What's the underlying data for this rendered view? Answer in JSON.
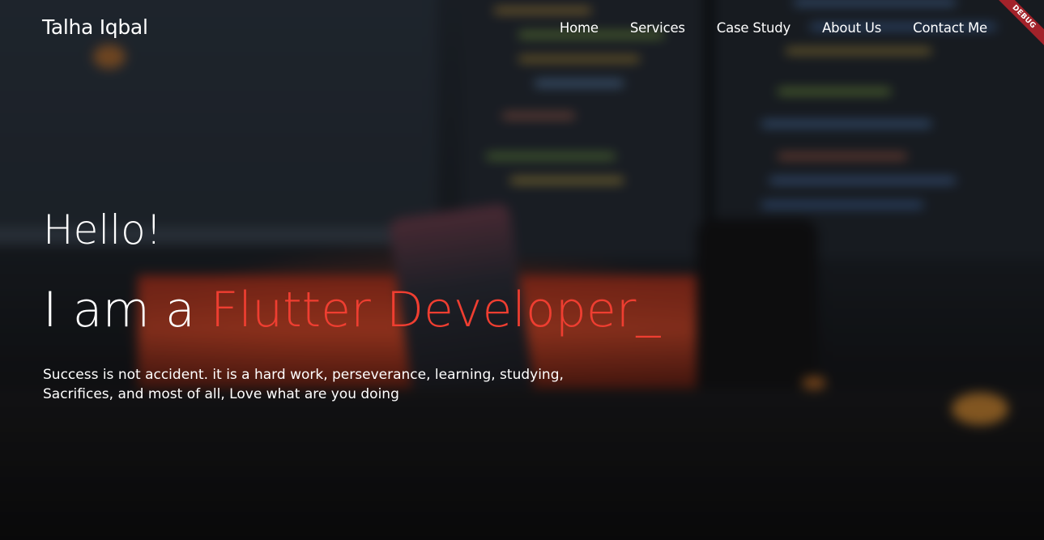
{
  "nav": {
    "brand": "Talha Iqbal",
    "items": [
      {
        "label": "Home"
      },
      {
        "label": "Services"
      },
      {
        "label": "Case Study"
      },
      {
        "label": "About Us"
      },
      {
        "label": "Contact Me"
      }
    ]
  },
  "debug_banner": "DEBUG",
  "hero": {
    "greeting": "Hello!",
    "headline_lead": "I am a ",
    "headline_role": "Flutter Developer_",
    "tagline_line1": "Success is not accident. it is a hard work, perseverance, learning, studying,",
    "tagline_line2": "Sacrifices, and most of all, Love what are you doing"
  },
  "colors": {
    "accent": "#ef3e31",
    "text": "#ffffff",
    "debug_banner": "#a2222a"
  }
}
